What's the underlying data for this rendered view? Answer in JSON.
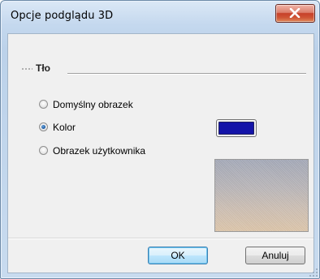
{
  "window": {
    "title": "Opcje podglądu 3D",
    "close_label": "X"
  },
  "group": {
    "title": "Tło"
  },
  "radios": [
    {
      "label": "Domyślny obrazek",
      "selected": false
    },
    {
      "label": "Kolor",
      "selected": true
    },
    {
      "label": "Obrazek użytkownika",
      "selected": false
    }
  ],
  "color": {
    "value": "#1414a8"
  },
  "buttons": {
    "ok": "OK",
    "cancel": "Anuluj"
  }
}
